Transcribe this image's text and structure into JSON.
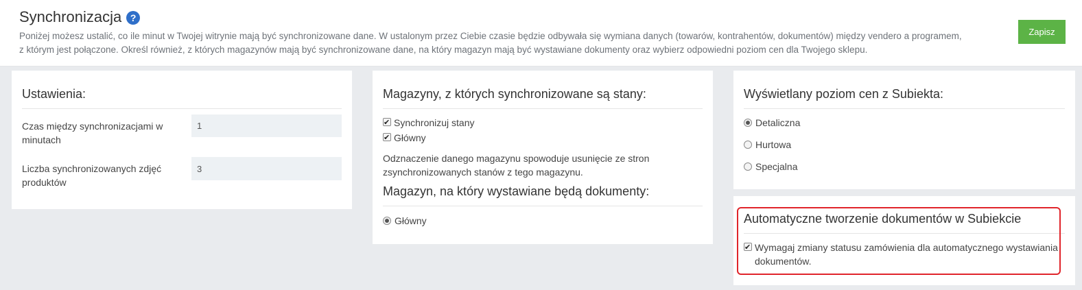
{
  "header": {
    "title": "Synchronizacja",
    "help_glyph": "?",
    "description": "Poniżej możesz ustalić, co ile minut w Twojej witrynie mają być synchronizowane dane. W ustalonym przez Ciebie czasie będzie odbywała się wymiana danych (towarów, kontrahentów, dokumentów) między vendero a programem, z którym jest połączone. Określ również, z których magazynów mają być synchronizowane dane, na który magazyn mają być wystawiane dokumenty oraz wybierz odpowiedni poziom cen dla Twojego sklepu.",
    "save_label": "Zapisz"
  },
  "settings": {
    "title": "Ustawienia:",
    "rows": [
      {
        "label": "Czas między synchronizacjami w minutach",
        "value": "1"
      },
      {
        "label": "Liczba synchronizowanych zdjęć produktów",
        "value": "3"
      }
    ]
  },
  "warehouses": {
    "title": "Magazyny, z których synchronizowane są stany:",
    "checks": [
      {
        "label": "Synchronizuj stany",
        "checked": true
      },
      {
        "label": "Główny",
        "checked": true
      }
    ],
    "note": "Odznaczenie danego magazynu spowoduje usunięcie ze stron zsynchronizowanych stanów z tego magazynu.",
    "doc_title": "Magazyn, na który wystawiane będą dokumenty:",
    "doc_options": [
      {
        "label": "Główny",
        "selected": true
      }
    ]
  },
  "prices": {
    "title": "Wyświetlany poziom cen z Subiekta:",
    "options": [
      {
        "label": "Detaliczna",
        "selected": true
      },
      {
        "label": "Hurtowa",
        "selected": false
      },
      {
        "label": "Specjalna",
        "selected": false
      }
    ]
  },
  "auto_docs": {
    "title": "Automatyczne tworzenie dokumentów w Subiekcie",
    "check_label": "Wymagaj zmiany statusu zamówienia dla automatycznego wystawiania dokumentów.",
    "checked": true
  },
  "colors": {
    "accent_blue": "#2f6fc9",
    "save_green": "#5cb346",
    "highlight_red": "#e0242a"
  }
}
